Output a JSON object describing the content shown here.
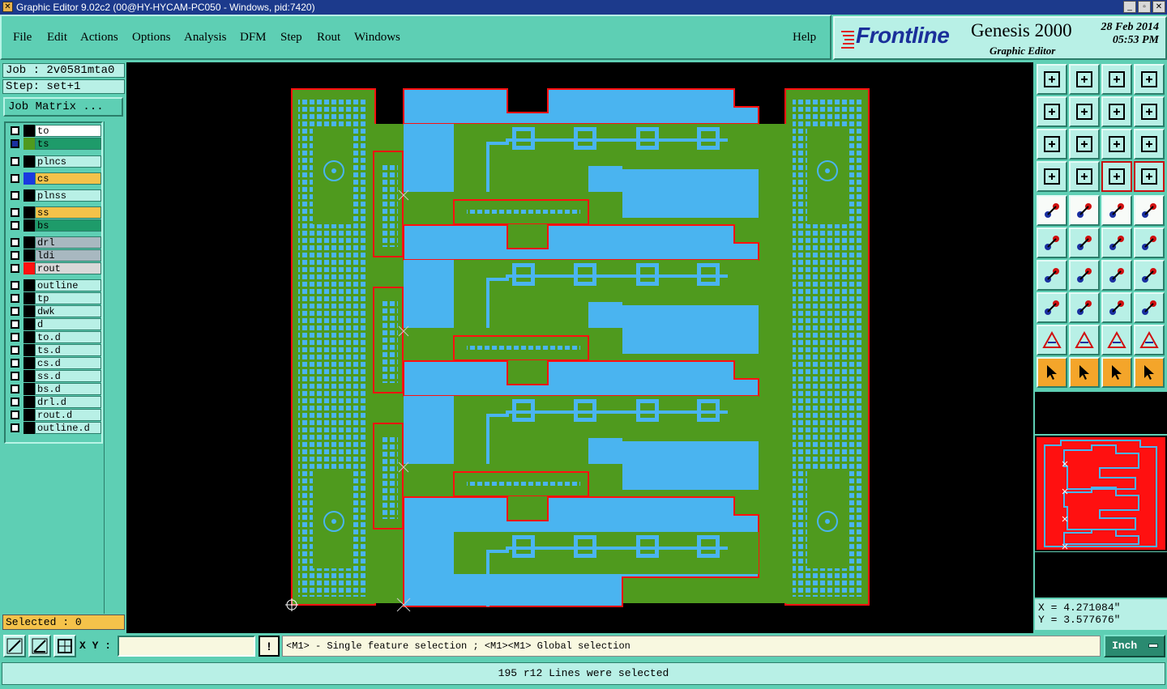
{
  "window": {
    "title": "Graphic Editor 9.02c2 (00@HY-HYCAM-PC050 - Windows, pid:7420)",
    "minimize": "_",
    "maximize": "▫",
    "close": "✕"
  },
  "menu": {
    "file": "File",
    "edit": "Edit",
    "actions": "Actions",
    "options": "Options",
    "analysis": "Analysis",
    "dfm": "DFM",
    "step": "Step",
    "rout": "Rout",
    "windows": "Windows",
    "help": "Help"
  },
  "logo": {
    "brand": "Frontline",
    "product": "Genesis 2000",
    "subtitle": "Graphic Editor",
    "date": "28 Feb 2014",
    "time": "05:53 PM"
  },
  "job": {
    "job_label": "Job : 2v0581mta0",
    "step_label": "Step: set+1",
    "matrix_button": "Job Matrix ..."
  },
  "layers": [
    {
      "name": "to",
      "bg": "#ffffff",
      "swatch": "#000000"
    },
    {
      "name": "ts",
      "bg": "#1e9b6a",
      "swatch": "#4f9a1e",
      "checked": true
    },
    {
      "name": "plncs",
      "bg": "#b8f0e6",
      "swatch": "#000000"
    },
    {
      "name": "cs",
      "bg": "#f4c24a",
      "swatch": "#1a3ae0"
    },
    {
      "name": "plnss",
      "bg": "#b8f0e6",
      "swatch": "#000000"
    },
    {
      "name": "ss",
      "bg": "#f4c24a",
      "swatch": "#000000"
    },
    {
      "name": "bs",
      "bg": "#1e9b6a",
      "swatch": "#000000"
    },
    {
      "name": "drl",
      "bg": "#a8b8c0",
      "swatch": "#000000"
    },
    {
      "name": "ldi",
      "bg": "#a8b8c0",
      "swatch": "#000000"
    },
    {
      "name": "rout",
      "bg": "#d8d8d8",
      "swatch": "#ff1010"
    },
    {
      "name": "outline",
      "bg": "#b8f0e6",
      "swatch": "#000000"
    },
    {
      "name": "tp",
      "bg": "#b8f0e6",
      "swatch": "#000000"
    },
    {
      "name": "dwk",
      "bg": "#b8f0e6",
      "swatch": "#000000"
    },
    {
      "name": "d",
      "bg": "#b8f0e6",
      "swatch": "#000000"
    },
    {
      "name": "to.d",
      "bg": "#b8f0e6",
      "swatch": "#000000"
    },
    {
      "name": "ts.d",
      "bg": "#b8f0e6",
      "swatch": "#000000"
    },
    {
      "name": "cs.d",
      "bg": "#b8f0e6",
      "swatch": "#000000"
    },
    {
      "name": "ss.d",
      "bg": "#b8f0e6",
      "swatch": "#000000"
    },
    {
      "name": "bs.d",
      "bg": "#b8f0e6",
      "swatch": "#000000"
    },
    {
      "name": "drl.d",
      "bg": "#b8f0e6",
      "swatch": "#000000"
    },
    {
      "name": "rout.d",
      "bg": "#b8f0e6",
      "swatch": "#000000"
    },
    {
      "name": "outline.d",
      "bg": "#b8f0e6",
      "swatch": "#000000"
    }
  ],
  "selection": {
    "label": "Selected : 0"
  },
  "coords": {
    "x": "X = 4.271084\"",
    "y": "Y = 3.577676\""
  },
  "bottom": {
    "xy_label": "X Y :",
    "xy_value": "",
    "excl": "!",
    "hint": "<M1> - Single feature selection ; <M1><M1> Global selection",
    "unit": "Inch",
    "status": "195 r12 Lines were selected"
  },
  "colors": {
    "board_green": "#4f9a1e",
    "copper_blue": "#4ab4f0",
    "rout_red": "#ff1010",
    "panel_teal": "#5ecfb4",
    "canvas_bg": "#000000"
  }
}
